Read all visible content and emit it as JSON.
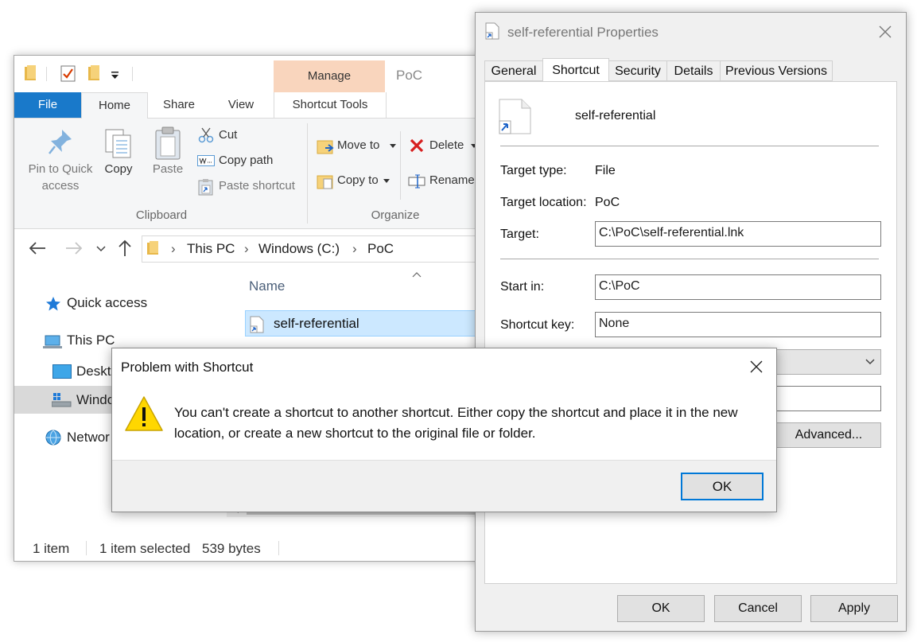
{
  "explorer": {
    "title": "PoC",
    "contextual_tab": "Manage",
    "tabs": [
      "File",
      "Home",
      "Share",
      "View",
      "Shortcut Tools"
    ],
    "clipboard": {
      "pin_label_1": "Pin to Quick",
      "pin_label_2": "access",
      "copy": "Copy",
      "paste": "Paste",
      "cut": "Cut",
      "copy_path": "Copy path",
      "paste_shortcut": "Paste shortcut",
      "group": "Clipboard"
    },
    "organize": {
      "move_to": "Move to",
      "copy_to": "Copy to",
      "delete": "Delete",
      "rename": "Rename",
      "group": "Organize"
    },
    "breadcrumb": [
      "This PC",
      "Windows (C:)",
      "PoC"
    ],
    "nav": {
      "quick_access": "Quick access",
      "this_pc": "This PC",
      "desktop": "Deskt",
      "windows": "Windo",
      "network": "Networ"
    },
    "column_name": "Name",
    "file_name": "self-referential",
    "status": {
      "items": "1 item",
      "selected": "1 item selected",
      "size": "539 bytes"
    }
  },
  "props": {
    "title": "self-referential Properties",
    "tabs": [
      "General",
      "Shortcut",
      "Security",
      "Details",
      "Previous Versions"
    ],
    "file_name": "self-referential",
    "target_type_label": "Target type:",
    "target_type": "File",
    "target_location_label": "Target location:",
    "target_location": "PoC",
    "target_label": "Target:",
    "target": "C:\\PoC\\self-referential.lnk",
    "start_in_label": "Start in:",
    "start_in": "C:\\PoC",
    "shortcut_key_label": "Shortcut key:",
    "shortcut_key": "None",
    "advanced": "Advanced...",
    "ok": "OK",
    "cancel": "Cancel",
    "apply": "Apply"
  },
  "dialog": {
    "title": "Problem with Shortcut",
    "message": "You can't create a shortcut to another shortcut. Either copy the shortcut and place it in the new location, or create a new shortcut to the original file or folder.",
    "ok": "OK"
  },
  "colors": {
    "accent": "#1979ca",
    "manage_tab": "#f9d5bd",
    "selection": "#cce8ff",
    "warning": "#ffd700",
    "delete_red": "#d71f1f"
  },
  "icons": [
    "folder-icon",
    "checklist-icon",
    "pin-icon",
    "copy-icon",
    "paste-icon",
    "scissors-icon",
    "copy-path-icon",
    "paste-shortcut-icon",
    "move-to-icon",
    "copy-to-icon",
    "delete-icon",
    "rename-icon",
    "back-arrow-icon",
    "forward-arrow-icon",
    "up-arrow-icon",
    "star-icon",
    "computer-icon",
    "desktop-icon",
    "drive-icon",
    "network-icon",
    "shortcut-file-icon",
    "warning-icon",
    "close-icon"
  ]
}
